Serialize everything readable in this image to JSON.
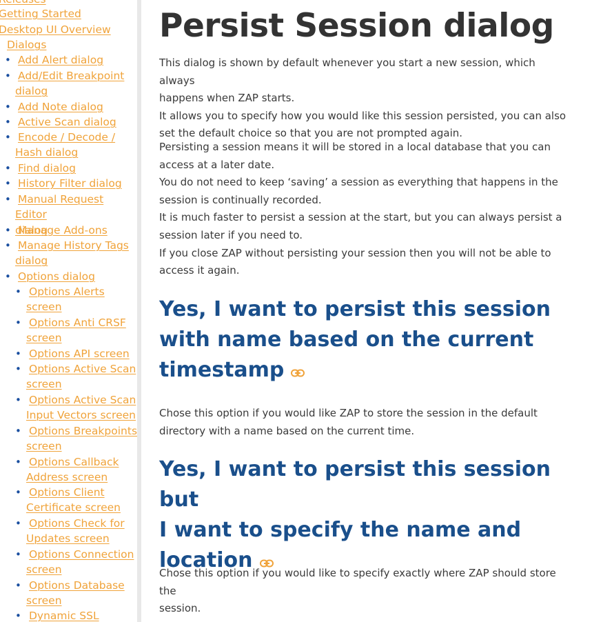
{
  "sidebar": {
    "items": [
      {
        "label": "Releases"
      },
      {
        "label": "Getting Started"
      },
      {
        "label": "Desktop UI Overview"
      }
    ],
    "dialogs": {
      "label": "Dialogs",
      "items": [
        {
          "line1": "Add Alert dialog",
          "line2": ""
        },
        {
          "line1": "Add/Edit Breakpoint",
          "line2": "dialog"
        },
        {
          "line1": "Add Note dialog",
          "line2": ""
        },
        {
          "line1": "Active Scan dialog",
          "line2": ""
        },
        {
          "line1": "Encode / Decode /",
          "line2": "Hash dialog"
        },
        {
          "line1": "Find dialog",
          "line2": ""
        },
        {
          "line1": "History Filter dialog",
          "line2": ""
        },
        {
          "line1": "Manual Request Editor",
          "line2": "dialog"
        },
        {
          "line1": "Manage Add-ons",
          "line2": ""
        },
        {
          "line1": "Manage History Tags",
          "line2": "dialog"
        },
        {
          "line1": "Options dialog",
          "line2": ""
        }
      ]
    },
    "options_items": [
      {
        "line1": "Options Alerts",
        "line2": "screen"
      },
      {
        "line1": "Options Anti CRSF",
        "line2": "screen"
      },
      {
        "line1": "Options API screen",
        "line2": ""
      },
      {
        "line1": "Options Active Scan",
        "line2": "screen"
      },
      {
        "line1": "Options Active Scan",
        "line2": "Input Vectors screen"
      },
      {
        "line1": "Options Breakpoints",
        "line2": "screen"
      },
      {
        "line1": "Options Callback",
        "line2": "Address screen"
      },
      {
        "line1": "Options Client",
        "line2": "Certificate screen"
      },
      {
        "line1": "Options Check for",
        "line2": "Updates screen"
      },
      {
        "line1": "Options Connection",
        "line2": "screen"
      },
      {
        "line1": "Options Database",
        "line2": "screen"
      },
      {
        "line1": "Dynamic SSL",
        "line2": ""
      }
    ]
  },
  "main": {
    "title": "Persist Session dialog",
    "intro": [
      "This dialog is shown by default whenever you start a new session, which always",
      "happens when ZAP starts.",
      "It allows you to specify how you would like this session persisted, you can also",
      "set the default choice so that you are not prompted again."
    ],
    "persisting": [
      "Persisting a session means it will be stored in a local database that you can",
      "access at a later date.",
      "You do not need to keep ‘saving’ a session as everything that happens in the",
      "session is continually recorded.",
      "It is much faster to persist a session at the start, but you can always persist a",
      "session later if you need to.",
      "If you close ZAP without persisting your session then you will not be able to",
      "access it again."
    ],
    "section1": {
      "heading_lines": [
        "Yes, I want to persist this session",
        "with name based on the current",
        "timestamp"
      ],
      "body": [
        "Chose this option if you would like ZAP to store the session in the default",
        "directory with a name based on the current time."
      ]
    },
    "section2": {
      "heading_lines": [
        "Yes, I want to persist this session but",
        "I want to specify the name and",
        "location"
      ],
      "body": [
        "Chose this option if you would like to specify exactly where ZAP should store the",
        "session."
      ]
    }
  },
  "colors": {
    "link": "#f0a33a",
    "heading": "#1a4f8b",
    "bullet": "#1a4fa0",
    "title": "#333333"
  },
  "icons": {
    "anchor": "link-icon"
  }
}
